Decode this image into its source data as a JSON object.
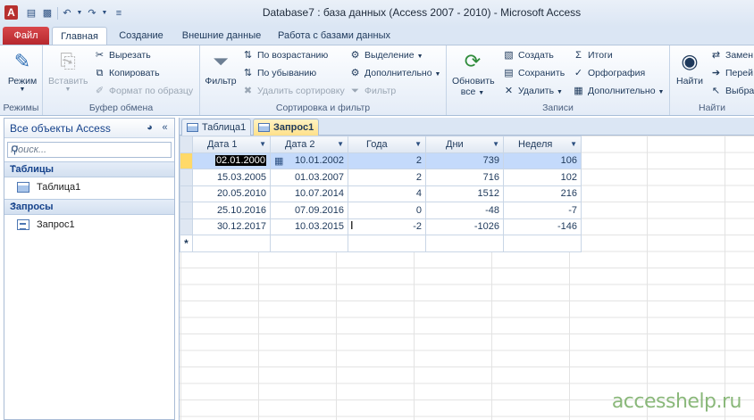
{
  "window": {
    "title": "Database7 : база данных (Access 2007 - 2010)  -  Microsoft Access",
    "app_icon": "A"
  },
  "quick_access": [
    "save-icon",
    "undo-icon",
    "redo-icon",
    "customize-icon"
  ],
  "ribbon_tabs": [
    "Файл",
    "Главная",
    "Создание",
    "Внешние данные",
    "Работа с базами данных"
  ],
  "ribbon": {
    "views": {
      "button": "Режим",
      "group": "Режимы"
    },
    "clipboard": {
      "paste": "Вставить",
      "cut": "Вырезать",
      "copy": "Копировать",
      "format_painter": "Формат по образцу",
      "group": "Буфер обмена"
    },
    "sort_filter": {
      "filter": "Фильтр",
      "asc": "По возрастанию",
      "desc": "По убыванию",
      "remove_sort": "Удалить сортировку",
      "selection": "Выделение",
      "advanced": "Дополнительно",
      "toggle_filter": "Фильтр",
      "group": "Сортировка и фильтр"
    },
    "records": {
      "refresh": "Обновить",
      "refresh_all": "все",
      "new": "Создать",
      "save": "Сохранить",
      "delete": "Удалить",
      "totals": "Итоги",
      "spelling": "Орфография",
      "more": "Дополнительно",
      "group": "Записи"
    },
    "find": {
      "find": "Найти",
      "replace": "Замен",
      "goto": "Перей",
      "select": "Выбра",
      "group": "Найти"
    }
  },
  "nav_pane": {
    "title": "Все объекты Access",
    "search_placeholder": "Поиск...",
    "categories": [
      {
        "name": "Таблицы",
        "items": [
          "Таблица1"
        ]
      },
      {
        "name": "Запросы",
        "items": [
          "Запрос1"
        ]
      }
    ]
  },
  "doc_tabs": [
    "Таблица1",
    "Запрос1"
  ],
  "datasheet": {
    "columns": [
      "Дата 1",
      "Дата 2",
      "Года",
      "Дни",
      "Неделя"
    ],
    "rows": [
      [
        "02.01.2000",
        "10.01.2002",
        "2",
        "739",
        "106"
      ],
      [
        "15.03.2005",
        "01.03.2007",
        "2",
        "716",
        "102"
      ],
      [
        "20.05.2010",
        "10.07.2014",
        "4",
        "1512",
        "216"
      ],
      [
        "25.10.2016",
        "07.09.2016",
        "0",
        "-48",
        "-7"
      ],
      [
        "30.12.2017",
        "10.03.2015",
        "-2",
        "-1026",
        "-146"
      ]
    ],
    "new_row_marker": "*"
  },
  "watermark": "accesshelp.ru"
}
